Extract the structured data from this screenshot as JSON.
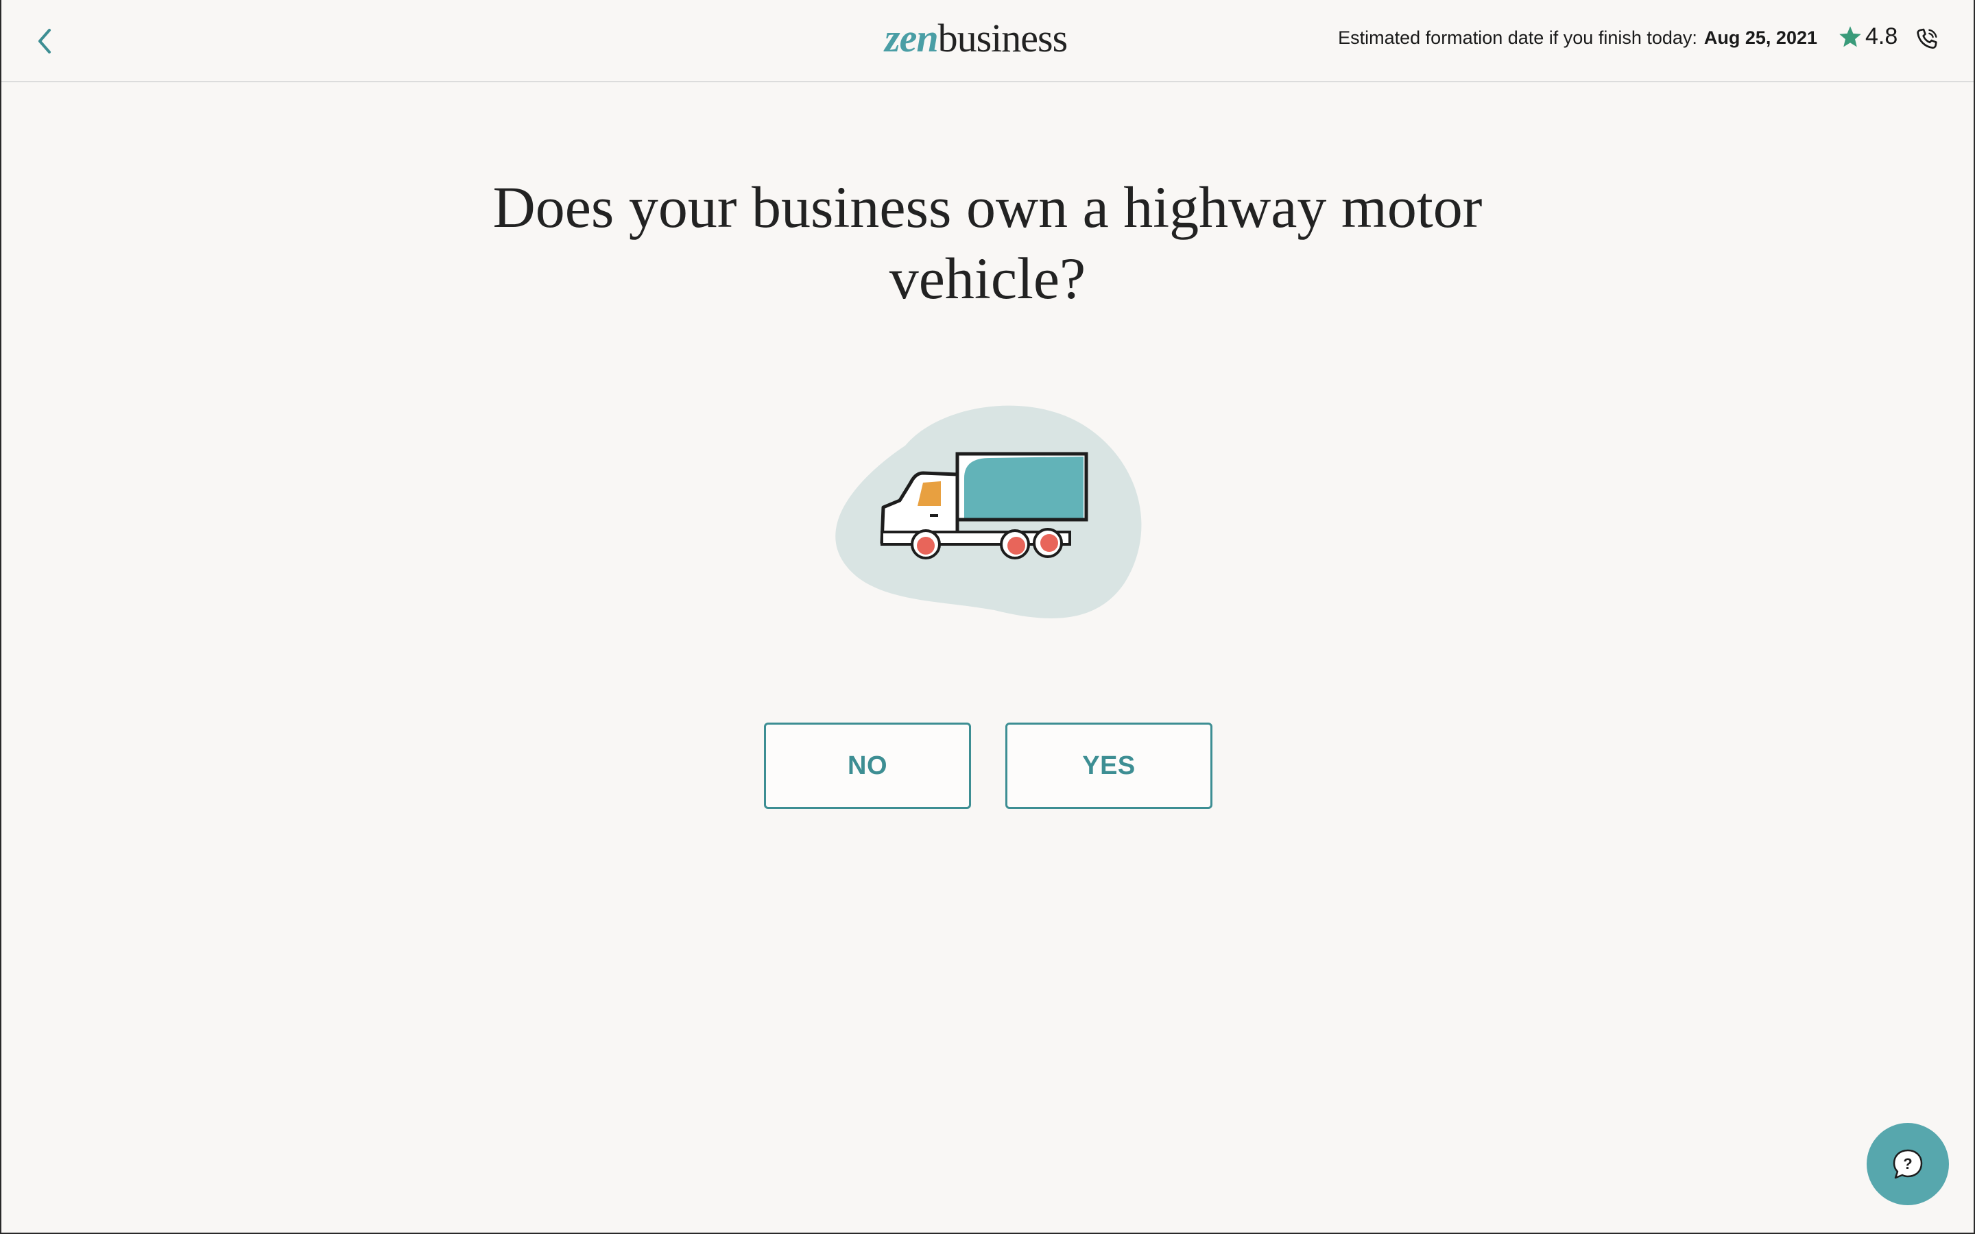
{
  "header": {
    "logo_zen": "zen",
    "logo_business": "business",
    "formation_label": "Estimated formation date if you finish today:",
    "formation_date": "Aug 25, 2021",
    "rating": "4.8"
  },
  "question": {
    "title": "Does your business own a highway motor vehicle?"
  },
  "answers": {
    "no_label": "NO",
    "yes_label": "YES"
  },
  "icons": {
    "back": "chevron-left-icon",
    "star": "star-icon",
    "phone": "phone-icon",
    "help": "help-chat-icon",
    "illustration": "truck-illustration"
  },
  "colors": {
    "accent": "#3d8e93",
    "star": "#3a9b7a",
    "background": "#f9f7f5",
    "illustration_blob": "#d9e4e3",
    "truck_cargo": "#62b3b8",
    "truck_window": "#e8a040",
    "truck_wheels": "#e8655a"
  }
}
